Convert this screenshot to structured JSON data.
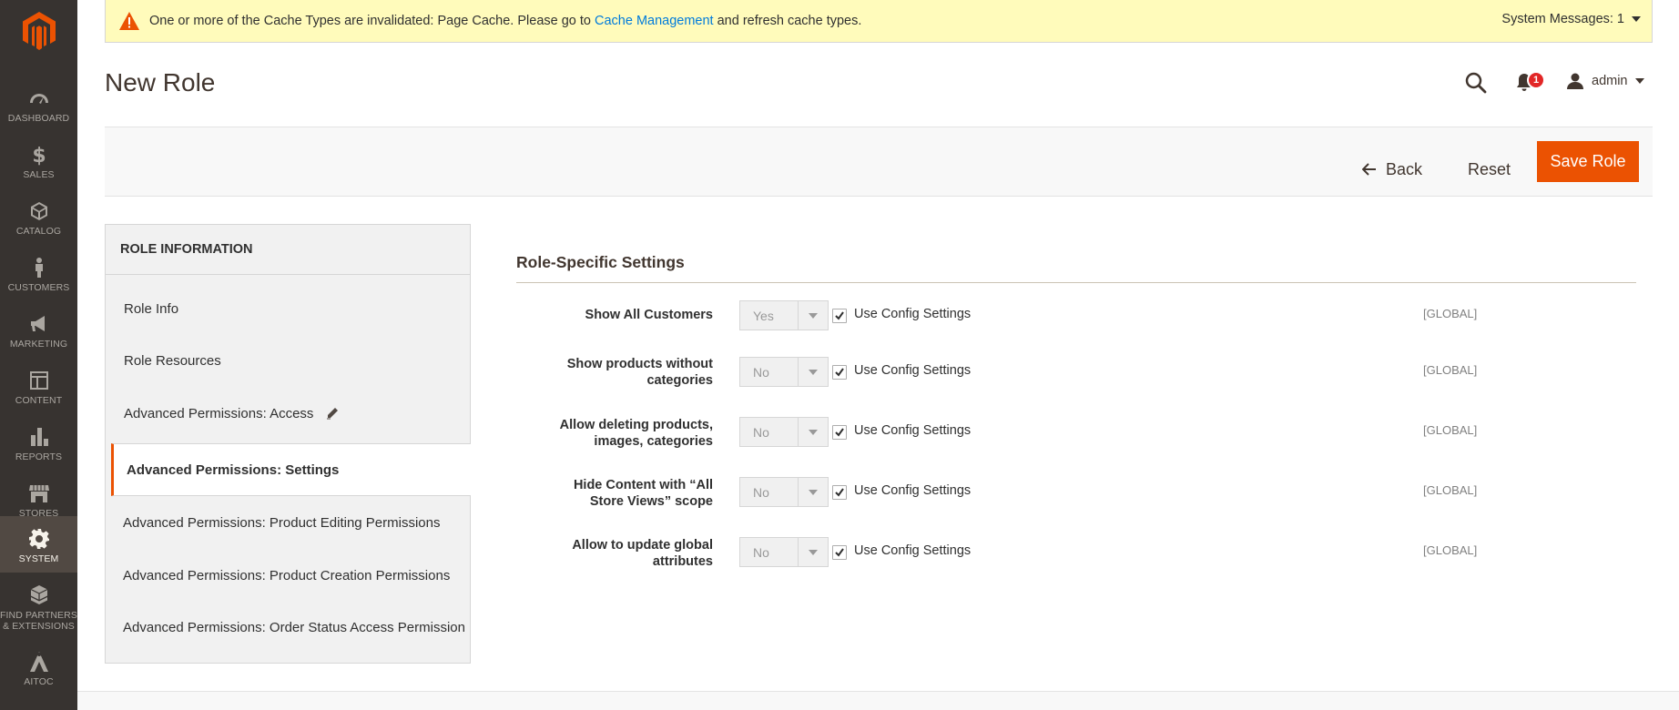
{
  "sidebar": {
    "items": [
      {
        "label": "DASHBOARD"
      },
      {
        "label": "SALES"
      },
      {
        "label": "CATALOG"
      },
      {
        "label": "CUSTOMERS"
      },
      {
        "label": "MARKETING"
      },
      {
        "label": "CONTENT"
      },
      {
        "label": "REPORTS"
      },
      {
        "label": "STORES"
      },
      {
        "label": "SYSTEM"
      },
      {
        "label_line1": "FIND PARTNERS",
        "label_line2": "& EXTENSIONS"
      },
      {
        "label": "AITOC"
      }
    ],
    "active": "SYSTEM"
  },
  "system_message": {
    "text_before": "One or more of the Cache Types are invalidated: Page Cache. Please go to ",
    "link": "Cache Management",
    "text_after": " and refresh cache types.",
    "right_label": "System Messages: 1"
  },
  "header": {
    "title": "New Role",
    "notifications_count": "1",
    "user": "admin"
  },
  "actions": {
    "back": "Back",
    "reset": "Reset",
    "save": "Save Role"
  },
  "tabs": {
    "title": "ROLE INFORMATION",
    "items": [
      {
        "label": "Role Info"
      },
      {
        "label": "Role Resources"
      },
      {
        "label": "Advanced Permissions: Access"
      },
      {
        "label": "Advanced Permissions: Settings"
      },
      {
        "label": "Advanced Permissions: Product Editing Permissions"
      },
      {
        "label": "Advanced Permissions: Product Creation Permissions"
      },
      {
        "label": "Advanced Permissions: Order Status Access Permission"
      }
    ],
    "active": "Advanced Permissions: Settings"
  },
  "settings": {
    "title": "Role-Specific Settings",
    "fields": [
      {
        "label_line1": "Show All Customers",
        "label_line2": "",
        "value": "Yes",
        "checkbox": "Use Config Settings",
        "checked": true,
        "scope": "[GLOBAL]"
      },
      {
        "label_line1": "Show products without",
        "label_line2": "categories",
        "value": "No",
        "checkbox": "Use Config Settings",
        "checked": true,
        "scope": "[GLOBAL]"
      },
      {
        "label_line1": "Allow deleting products,",
        "label_line2": "images, categories",
        "value": "No",
        "checkbox": "Use Config Settings",
        "checked": true,
        "scope": "[GLOBAL]"
      },
      {
        "label_line1": "Hide Content with “All",
        "label_line2": "Store Views” scope",
        "value": "No",
        "checkbox": "Use Config Settings",
        "checked": true,
        "scope": "[GLOBAL]"
      },
      {
        "label_line1": "Allow to update global",
        "label_line2": "attributes",
        "value": "No",
        "checkbox": "Use Config Settings",
        "checked": true,
        "scope": "[GLOBAL]"
      }
    ]
  },
  "colors": {
    "accent": "#eb5202",
    "sidebar_bg": "#373330",
    "message_bg": "#fffbbb",
    "link": "#007bdb"
  }
}
